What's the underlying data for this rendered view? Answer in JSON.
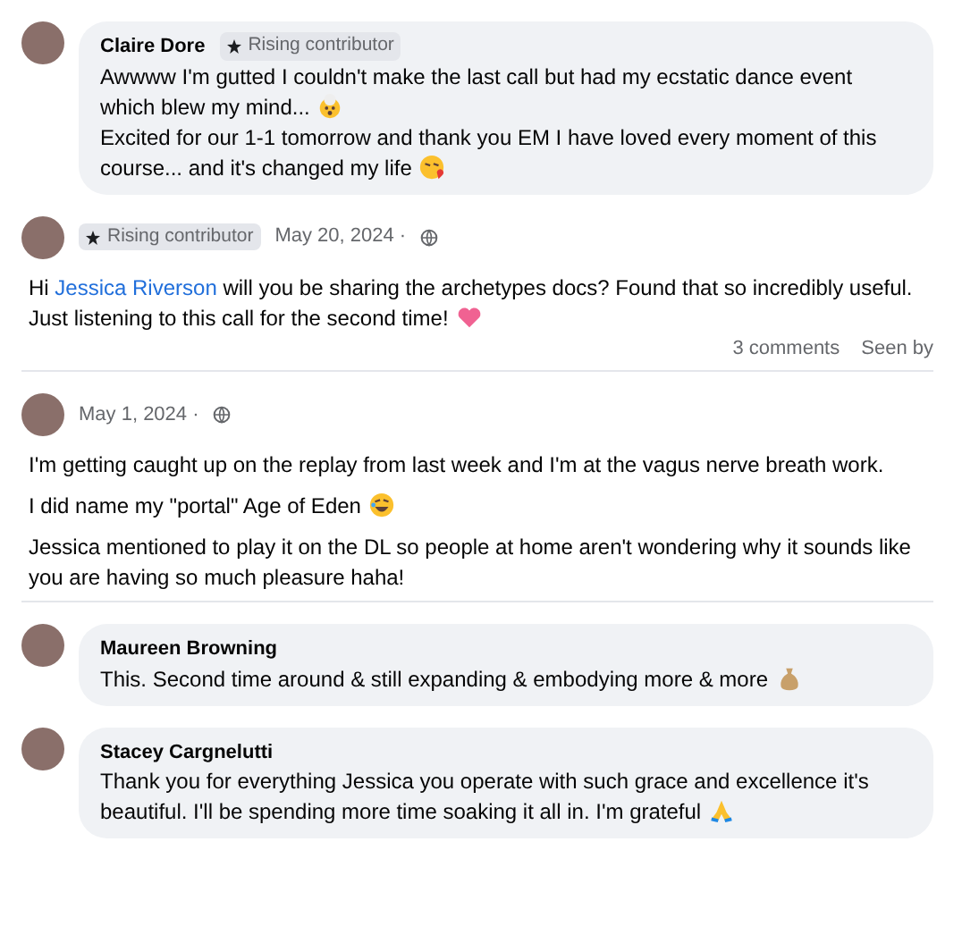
{
  "items": [
    {
      "kind": "bubble",
      "author": "Claire Dore",
      "badge": "Rising contributor",
      "paragraphs": [
        {
          "kind": "exploding-head",
          "segments": [
            {
              "kind": "plain",
              "text": "Awwww I'm gutted I couldn't make the last call but had my ecstatic dance event which blew my mind..."
            }
          ]
        },
        {
          "kind": "kiss",
          "segments": [
            {
              "kind": "plain",
              "text": "Excited for our 1-1 tomorrow and thank you EM I have loved every moment of this course... and it's changed my life"
            }
          ]
        }
      ]
    },
    {
      "kind": "post",
      "badge": "Rising contributor",
      "date": "May 20, 2024 ·",
      "paragraphs": [
        {
          "kind": "heart",
          "segments": [
            {
              "kind": "plain",
              "text": "Hi "
            },
            {
              "kind": "mention",
              "text": "Jessica Riverson"
            },
            {
              "kind": "plain",
              "text": " will you be sharing the archetypes docs? Found that so incredibly useful. Just listening to this call for the second time!"
            }
          ]
        }
      ],
      "footer": [
        "3 comments",
        "Seen by"
      ]
    },
    {
      "kind": "post",
      "date": "May 1, 2024 ·",
      "paragraphs": [
        {
          "kind": "plain",
          "segments": [
            {
              "kind": "plain",
              "text": "I'm getting caught up on the replay from last week and I'm at the vagus nerve breath work."
            }
          ]
        },
        {
          "kind": "laugh",
          "segments": [
            {
              "kind": "plain",
              "text": "I did name my \"portal\" Age of Eden"
            }
          ]
        },
        {
          "kind": "plain",
          "segments": [
            {
              "kind": "plain",
              "text": "Jessica mentioned to play it on the DL so people at home aren't wondering why it sounds like you are having so much pleasure haha!"
            }
          ]
        }
      ]
    },
    {
      "kind": "bubble",
      "author": "Maureen Browning",
      "paragraphs": [
        {
          "kind": "money-bag",
          "segments": [
            {
              "kind": "plain",
              "text": "This. Second time around & still expanding & embodying more & more"
            }
          ]
        }
      ]
    },
    {
      "kind": "bubble",
      "author": "Stacey Cargnelutti",
      "paragraphs": [
        {
          "kind": "pray",
          "segments": [
            {
              "kind": "plain",
              "text": "Thank you for everything Jessica you operate with such grace and excellence it's beautiful. I'll be spending more time soaking it all in. I'm grateful"
            }
          ]
        }
      ]
    }
  ]
}
